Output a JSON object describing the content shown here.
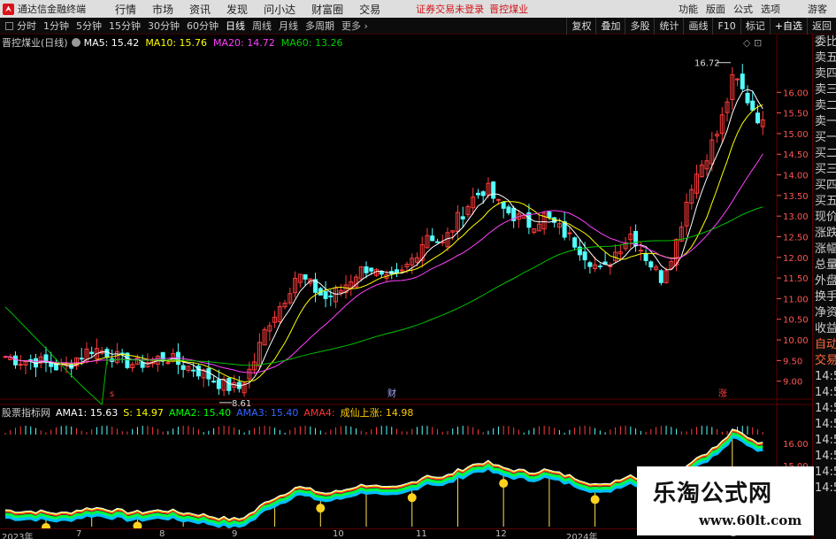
{
  "app": {
    "title": "通达信金融终端"
  },
  "menu": [
    "行情",
    "市场",
    "资讯",
    "发现",
    "问小达",
    "财富圈",
    "交易"
  ],
  "warning": {
    "text": "证券交易未登录",
    "stock": "晋控煤业"
  },
  "right_menu": [
    "功能",
    "版面",
    "公式",
    "选项"
  ],
  "guest": "游客",
  "periods": [
    "分时",
    "1分钟",
    "5分钟",
    "15分钟",
    "30分钟",
    "60分钟",
    "日线",
    "周线",
    "月线",
    "多周期",
    "更多"
  ],
  "active_period": "日线",
  "tools": [
    "复权",
    "叠加",
    "多股",
    "统计",
    "画线",
    "F10",
    "标记",
    "+自选",
    "返回"
  ],
  "main_legend": {
    "name": "晋控煤业(日线)",
    "ma5": "MA5: 15.42",
    "ma10": "MA10: 15.76",
    "ma20": "MA20: 14.72",
    "ma60": "MA60: 13.26"
  },
  "colors": {
    "ma5": "#ffffff",
    "ma10": "#ffff00",
    "ma20": "#ff40ff",
    "ma60": "#00c000",
    "up": "#ff3b3b",
    "down": "#54ffff",
    "axis": "#ff5555",
    "grid": "#5a0000"
  },
  "price_axis": [
    "16.00",
    "15.50",
    "15.00",
    "14.50",
    "14.00",
    "13.50",
    "13.00",
    "12.50",
    "12.00",
    "11.50",
    "11.00",
    "10.50",
    "10.00",
    "9.50",
    "9.00"
  ],
  "annotations": {
    "high": "16.72",
    "low": "8.61",
    "mark_1": "s",
    "mark_2": "财",
    "mark_3": "涨"
  },
  "side_panel": [
    "委比",
    "卖五",
    "卖四",
    "卖三",
    "卖二",
    "卖一",
    "买一",
    "买二",
    "买三",
    "买四",
    "买五",
    "现价",
    "涨跌",
    "涨幅",
    "总量",
    "外盘",
    "换手",
    "净资",
    "收益",
    "自动",
    "交易",
    "14:5",
    "14:5",
    "14:5",
    "14:5",
    "14:5",
    "14:5",
    "14:5",
    "14:5"
  ],
  "indicator": {
    "name": "股票指标网",
    "ama1": "AMA1: 15.63",
    "s": "S: 14.97",
    "ama2": "AMA2: 15.40",
    "ama3": "AMA3: 15.40",
    "ama4": "AMA4:",
    "signal": "成仙上涨: 14.98",
    "axis": [
      "16.00",
      "15.00",
      "14.00"
    ]
  },
  "dates": [
    "2023年",
    "7",
    "8",
    "9",
    "10",
    "11",
    "12",
    "2024年",
    "2"
  ],
  "watermark": {
    "main": "乐淘公式网",
    "url": "www.60lt.com"
  },
  "chart_data": {
    "type": "candlestick",
    "title": "晋控煤业(日线)",
    "close_path": [
      9.6,
      9.5,
      9.5,
      9.4,
      9.3,
      9.6,
      9.8,
      9.7,
      9.5,
      9.4,
      9.5,
      9.6,
      9.4,
      9.3,
      9.1,
      8.9,
      8.8,
      9.4,
      10.4,
      10.9,
      11.6,
      11.3,
      11.0,
      11.2,
      11.6,
      11.8,
      11.4,
      11.5,
      12.0,
      12.6,
      12.3,
      12.9,
      13.4,
      13.7,
      13.2,
      13.0,
      12.8,
      13.0,
      12.7,
      12.4,
      12.0,
      11.6,
      12.2,
      12.6,
      12.0,
      11.5,
      12.3,
      13.7,
      14.4,
      15.1,
      16.4,
      15.8,
      15.2
    ],
    "ylim": [
      8.5,
      16.8
    ],
    "high_label": 16.72,
    "low_label": 8.61,
    "ma_values": {
      "MA5": 15.42,
      "MA10": 15.76,
      "MA20": 14.72,
      "MA60": 13.26
    },
    "x_labels": [
      "2023年",
      "7",
      "8",
      "9",
      "10",
      "11",
      "12",
      "2024年",
      "2"
    ]
  }
}
